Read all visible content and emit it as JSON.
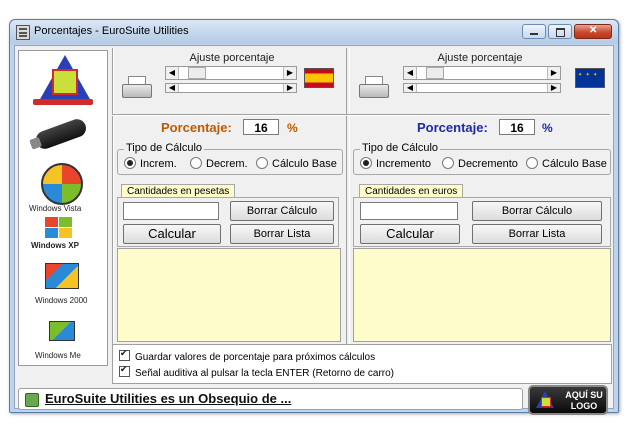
{
  "window": {
    "title": "Porcentajes - EuroSuite Utilities"
  },
  "pesetas": {
    "slider_label": "Ajuste porcentaje",
    "flag": "flag-spain",
    "percent_label": "Porcentaje:",
    "percent_value": "16",
    "percent_sign": "%",
    "calc_group_title": "Tipo de Cálculo",
    "radios": [
      "Increm.",
      "Decrem.",
      "Cálculo Base"
    ],
    "selected_radio": "Increm.",
    "amount_tab": "Cantidades en pesetas",
    "amount_value": "",
    "btn_borrar_calculo": "Borrar Cálculo",
    "btn_calcular": "Calcular",
    "btn_borrar_lista": "Borrar Lista"
  },
  "euros": {
    "slider_label": "Ajuste porcentaje",
    "flag": "flag-eu",
    "percent_label": "Porcentaje:",
    "percent_value": "16",
    "percent_sign": "%",
    "calc_group_title": "Tipo de Cálculo",
    "radios": [
      "Incremento",
      "Decremento",
      "Cálculo Base"
    ],
    "selected_radio": "Incremento",
    "amount_tab": "Cantidades en euros",
    "amount_value": "",
    "btn_borrar_calculo": "Borrar Cálculo",
    "btn_calcular": "Calcular",
    "btn_borrar_lista": "Borrar Lista"
  },
  "sidebar": {
    "os_labels": [
      "Windows Vista",
      "Windows XP",
      "Windows 2000",
      "Windows Me"
    ]
  },
  "options": {
    "check1": "Guardar valores de porcentaje para próximos cálculos",
    "check2": "Señal auditiva al pulsar la tecla ENTER (Retorno de carro)"
  },
  "status": {
    "text": "EuroSuite Utilities es un Obsequio de ..."
  },
  "logo_button": {
    "line1": "AQUÍ SU",
    "line2": "LOGO"
  },
  "colors": {
    "accent_title": "#c05a00",
    "euro_label": "#1d2aa8",
    "results_bg": "#fffccc"
  }
}
